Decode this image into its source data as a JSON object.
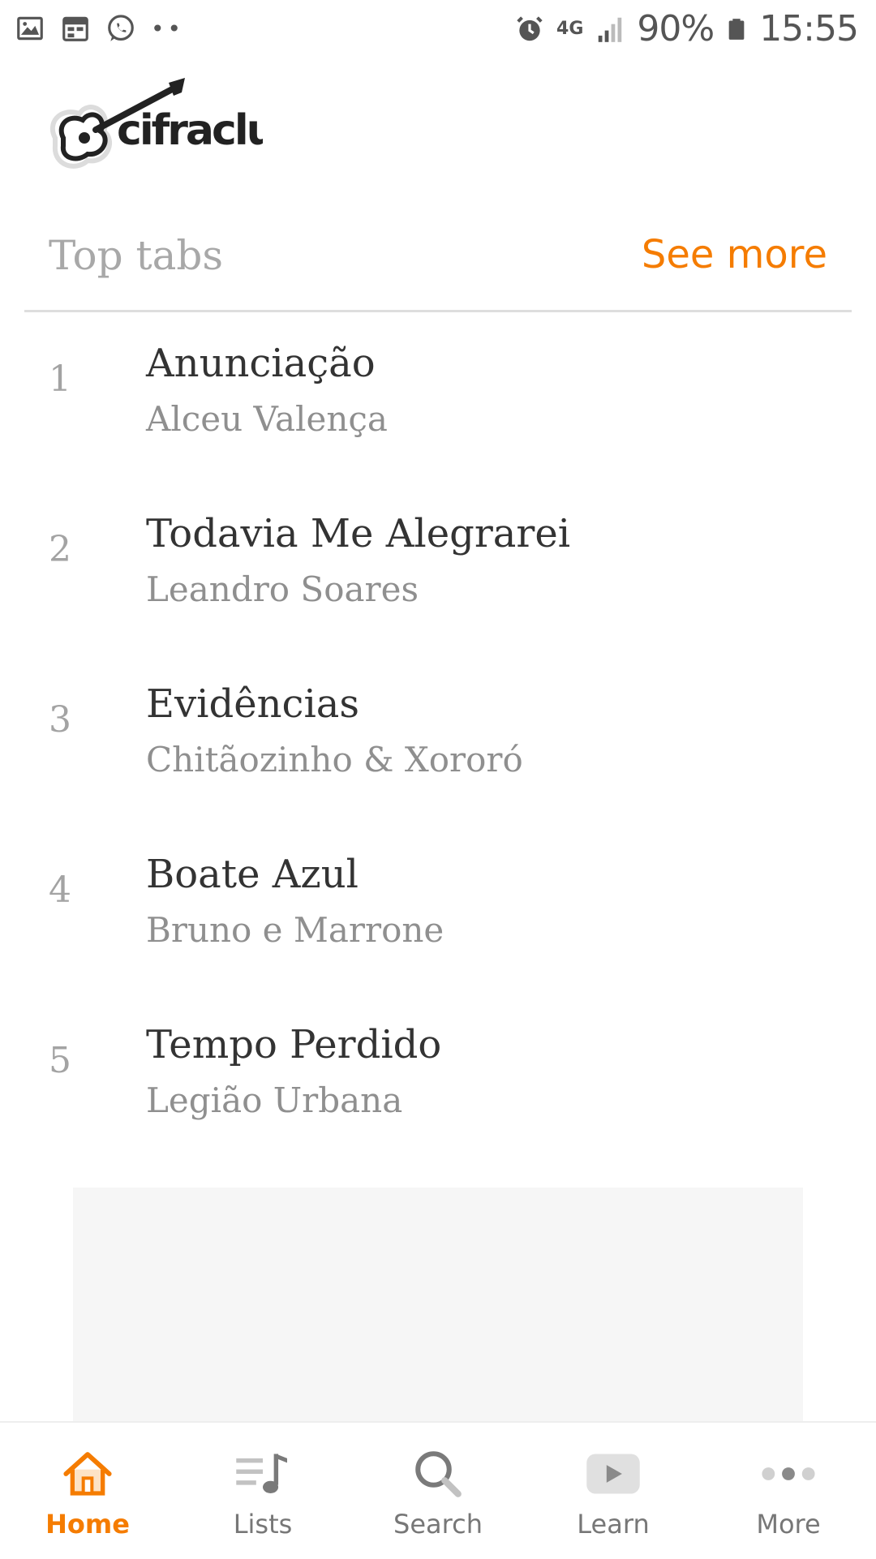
{
  "status_bar": {
    "left_icons": [
      "image-icon",
      "calendar-icon",
      "whatsapp-icon",
      "more-dots-icon"
    ],
    "network": "4G",
    "battery": "90%",
    "time": "15:55"
  },
  "brand": {
    "logo_text": "cifraclub"
  },
  "section": {
    "title": "Top tabs",
    "see_more": "See more"
  },
  "tabs": [
    {
      "rank": "1",
      "title": "Anunciação",
      "artist": "Alceu Valença"
    },
    {
      "rank": "2",
      "title": "Todavia Me Alegrarei",
      "artist": "Leandro Soares"
    },
    {
      "rank": "3",
      "title": "Evidências",
      "artist": "Chitãozinho & Xororó"
    },
    {
      "rank": "4",
      "title": "Boate Azul",
      "artist": "Bruno e Marrone"
    },
    {
      "rank": "5",
      "title": "Tempo Perdido",
      "artist": "Legião Urbana"
    }
  ],
  "bottom_nav": [
    {
      "label": "Home",
      "icon": "home-icon",
      "active": true
    },
    {
      "label": "Lists",
      "icon": "lists-icon",
      "active": false
    },
    {
      "label": "Search",
      "icon": "search-icon",
      "active": false
    },
    {
      "label": "Learn",
      "icon": "learn-icon",
      "active": false
    },
    {
      "label": "More",
      "icon": "more-icon",
      "active": false
    }
  ],
  "colors": {
    "accent": "#f57c00",
    "title_text": "#333333",
    "secondary_text": "#8f8f8f"
  }
}
